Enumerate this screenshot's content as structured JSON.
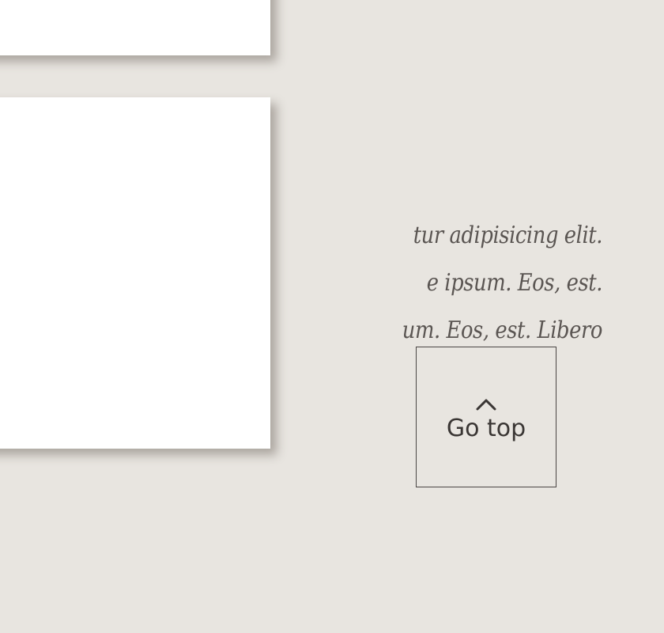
{
  "cards": [
    {
      "name": "top-card"
    },
    {
      "name": "main-card",
      "lines": [
        "tur adipisicing elit.",
        "e ipsum. Eos, est.",
        "um. Eos, est. Libero"
      ]
    }
  ],
  "go_top": {
    "icon": "chevron-up-icon",
    "label": "Go top"
  },
  "colors": {
    "background": "#e8e5e0",
    "card": "#ffffff",
    "text": "#5a5552",
    "button_border": "#4a4644"
  }
}
